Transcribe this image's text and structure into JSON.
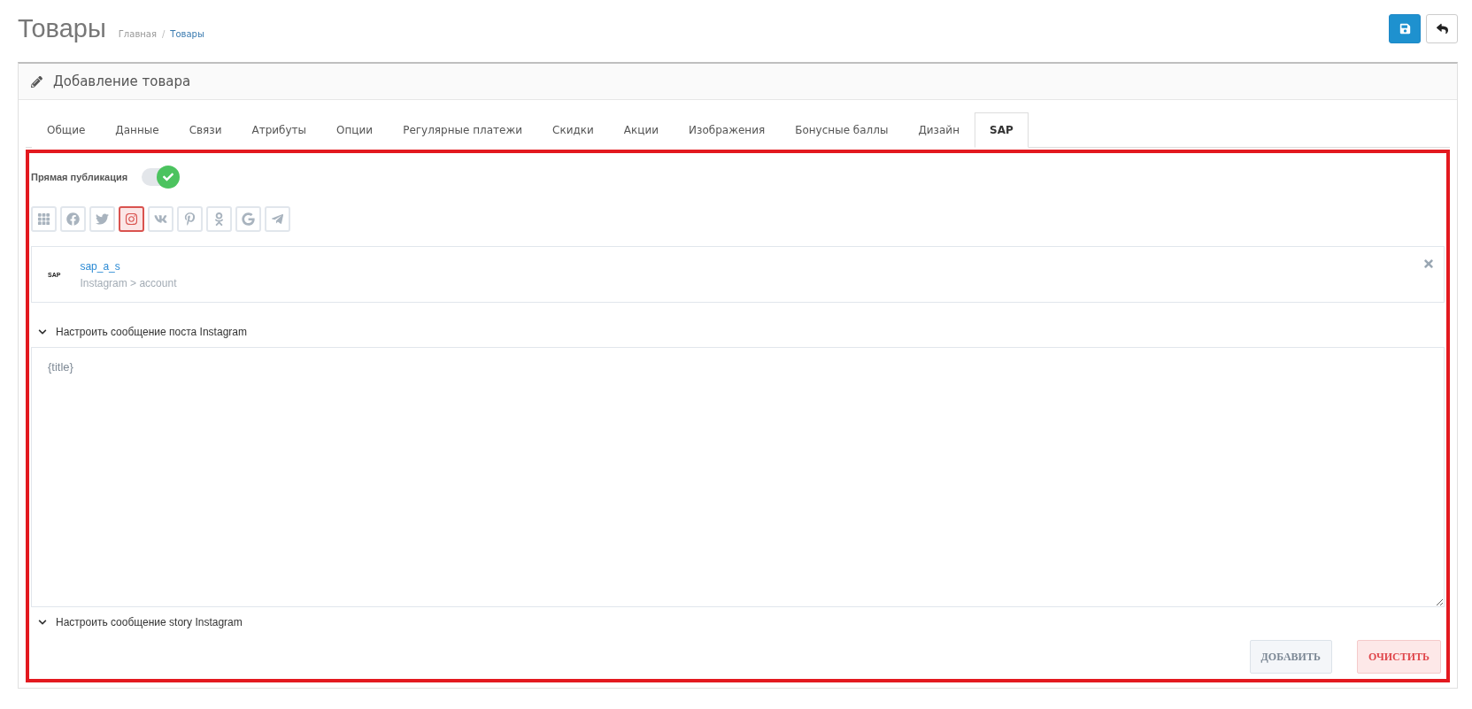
{
  "page": {
    "title": "Товары",
    "breadcrumbs": [
      {
        "label": "Главная",
        "kind": "home"
      },
      {
        "label": "Товары",
        "kind": "current"
      }
    ],
    "breadcrumb_separator": "/"
  },
  "header_buttons": [
    {
      "kind": "save"
    },
    {
      "kind": "back"
    }
  ],
  "panel": {
    "title": "Добавление товара"
  },
  "tabs": [
    {
      "label": "Общие",
      "selected": false
    },
    {
      "label": "Данные",
      "selected": false
    },
    {
      "label": "Связи",
      "selected": false
    },
    {
      "label": "Атрибуты",
      "selected": false
    },
    {
      "label": "Опции",
      "selected": false
    },
    {
      "label": "Регулярные платежи",
      "selected": false
    },
    {
      "label": "Скидки",
      "selected": false
    },
    {
      "label": "Акции",
      "selected": false
    },
    {
      "label": "Изображения",
      "selected": false
    },
    {
      "label": "Бонусные баллы",
      "selected": false
    },
    {
      "label": "Дизайн",
      "selected": false
    },
    {
      "label": "SAP",
      "selected": true
    }
  ],
  "direct_publish": {
    "label": "Прямая публикация",
    "on": true
  },
  "networks": [
    {
      "kind": "all",
      "selected": false
    },
    {
      "kind": "facebook",
      "selected": false
    },
    {
      "kind": "twitter",
      "selected": false
    },
    {
      "kind": "instagram",
      "selected": true
    },
    {
      "kind": "vk",
      "selected": false
    },
    {
      "kind": "pinterest",
      "selected": false
    },
    {
      "kind": "odnoklassniki",
      "selected": false
    },
    {
      "kind": "google",
      "selected": false
    },
    {
      "kind": "telegram",
      "selected": false
    }
  ],
  "account": {
    "logo": "SAP",
    "name": "sap_a_s",
    "path": "Instagram > account"
  },
  "sections": [
    {
      "label": "Настроить сообщение поста Instagram",
      "value": "{title}"
    },
    {
      "label": "Настроить сообщение story Instagram"
    }
  ],
  "actions": [
    {
      "label": "ДОБАВИТЬ",
      "kind": "add"
    },
    {
      "label": "ОЧИСТИТЬ",
      "kind": "clear"
    }
  ]
}
